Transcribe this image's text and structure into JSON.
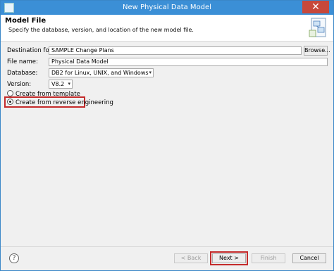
{
  "window": {
    "title": "New Physical Data Model",
    "close_glyph": "✕"
  },
  "header": {
    "title": "Model File",
    "description": "Specify the database, version, and location of the new model file."
  },
  "form": {
    "destination_label": "Destination folder:",
    "destination_value": "SAMPLE Change Plans",
    "browse_label": "Browse...",
    "file_name_label": "File name:",
    "file_name_value": "Physical Data Model",
    "database_label": "Database:",
    "database_value": "DB2 for Linux, UNIX, and Windows",
    "version_label": "Version:",
    "version_value": "V8.2",
    "dropdown_glyph": "▾"
  },
  "options": {
    "template_label": "Create from template",
    "reverse_label": "Create from reverse engineering",
    "selected": "reverse"
  },
  "footer": {
    "help_glyph": "?",
    "back_label": "< Back",
    "next_label": "Next >",
    "finish_label": "Finish",
    "cancel_label": "Cancel"
  },
  "colors": {
    "titlebar": "#3b8fd6",
    "close": "#c7483b",
    "highlight": "#c42b2b"
  },
  "icons": [
    "app-icon",
    "close-icon",
    "data-model-banner-icon",
    "help-icon"
  ]
}
